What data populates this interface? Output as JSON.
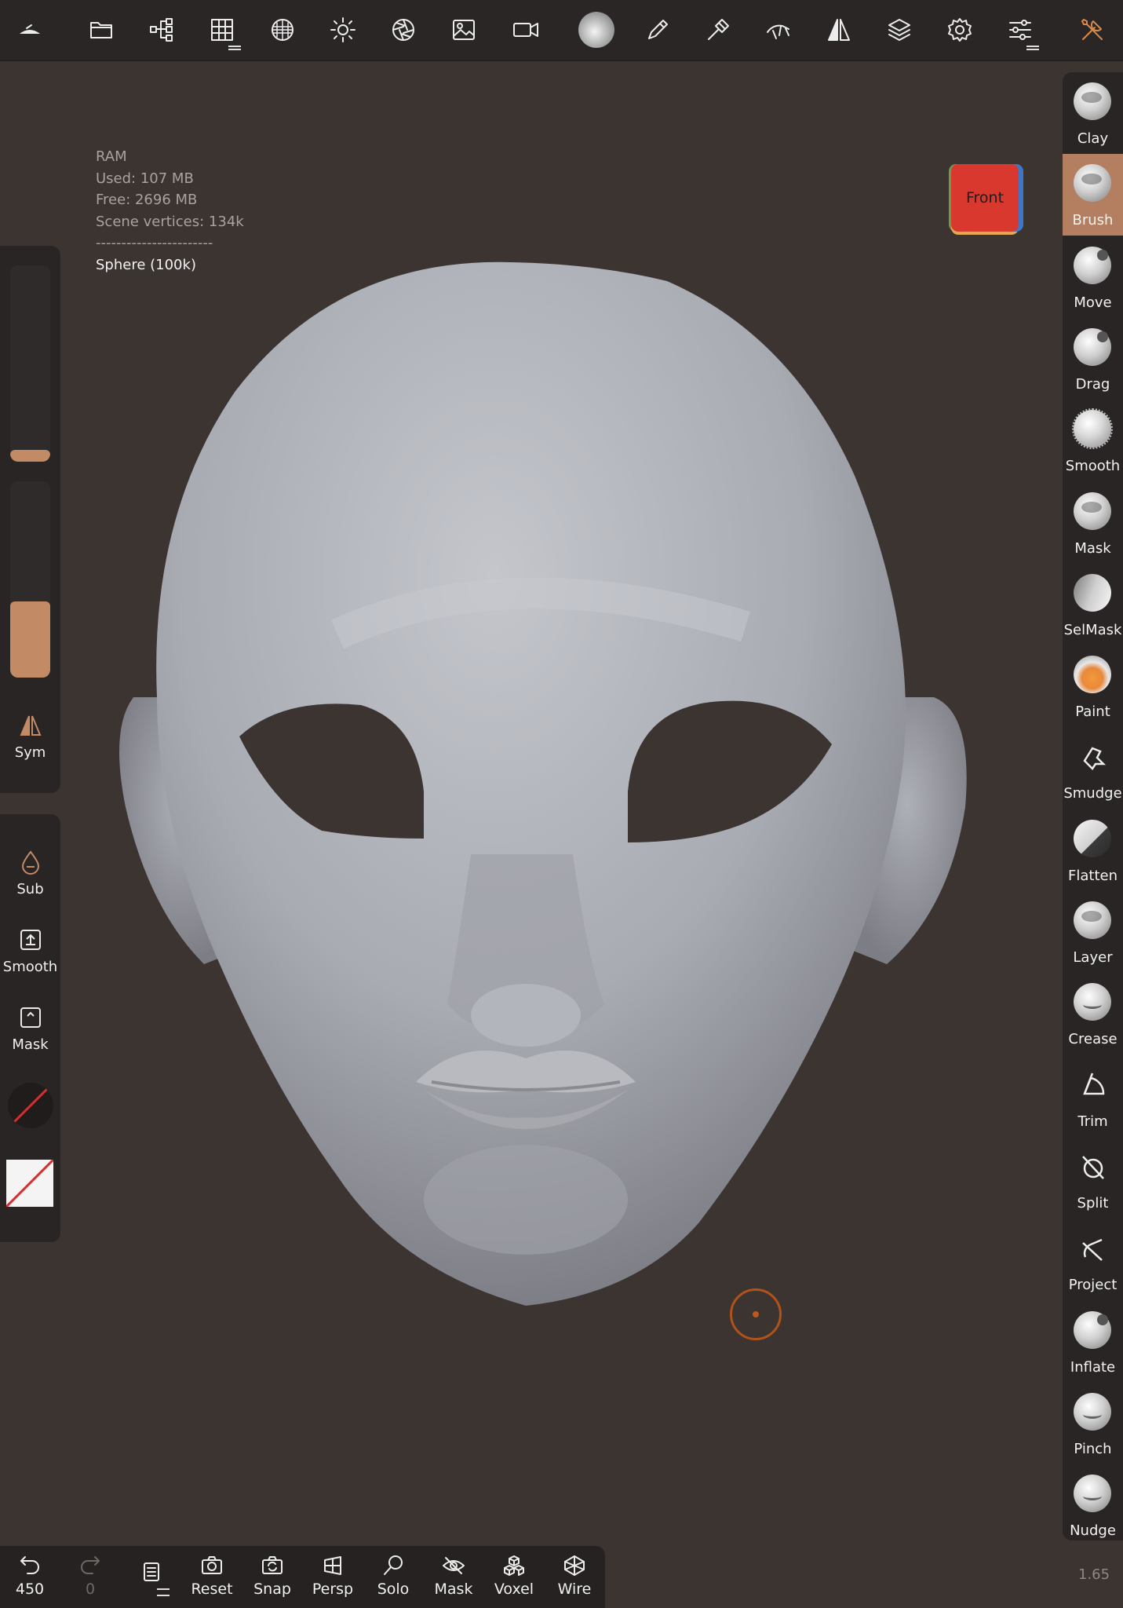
{
  "topbar": {
    "icons": [
      "nomad-logo-icon",
      "folder-icon",
      "scene-tree-icon",
      "grid-icon",
      "material-icon",
      "light-icon",
      "aperture-icon",
      "image-icon",
      "video-camera-icon",
      "matcap-sphere-icon",
      "pen-icon",
      "hammer-icon",
      "pose-icon",
      "symmetry-icon",
      "layers-icon",
      "settings-icon",
      "sliders-icon",
      "tools-icon"
    ]
  },
  "stats": {
    "ram": "RAM",
    "used": "Used: 107 MB",
    "free": "Free: 2696 MB",
    "vertices": "Scene vertices: 134k",
    "separator": "-----------------------",
    "mesh": "Sphere (100k)"
  },
  "view_cube": {
    "label": "Front",
    "color": "#d9382e"
  },
  "left_panel": {
    "radius_slider": {
      "value": 0.06
    },
    "intensity_slider": {
      "value": 0.39
    },
    "sym": "Sym",
    "sub": "Sub",
    "smooth": "Smooth",
    "mask": "Mask"
  },
  "tools": [
    {
      "label": "Clay",
      "active": false
    },
    {
      "label": "Brush",
      "active": true
    },
    {
      "label": "Move",
      "active": false
    },
    {
      "label": "Drag",
      "active": false
    },
    {
      "label": "Smooth",
      "active": false
    },
    {
      "label": "Mask",
      "active": false
    },
    {
      "label": "SelMask",
      "active": false
    },
    {
      "label": "Paint",
      "active": false
    },
    {
      "label": "Smudge",
      "active": false
    },
    {
      "label": "Flatten",
      "active": false
    },
    {
      "label": "Layer",
      "active": false
    },
    {
      "label": "Crease",
      "active": false
    },
    {
      "label": "Trim",
      "active": false
    },
    {
      "label": "Split",
      "active": false
    },
    {
      "label": "Project",
      "active": false
    },
    {
      "label": "Inflate",
      "active": false
    },
    {
      "label": "Pinch",
      "active": false
    },
    {
      "label": "Nudge",
      "active": false
    }
  ],
  "bottom": {
    "undo_count": "450",
    "redo_count": "0",
    "reset": "Reset",
    "snap": "Snap",
    "persp": "Persp",
    "solo": "Solo",
    "mask": "Mask",
    "voxel": "Voxel",
    "wire": "Wire"
  },
  "version": "1.65",
  "colors": {
    "accent": "#b47f61",
    "background": "#3b3431",
    "panel": "#292524"
  }
}
